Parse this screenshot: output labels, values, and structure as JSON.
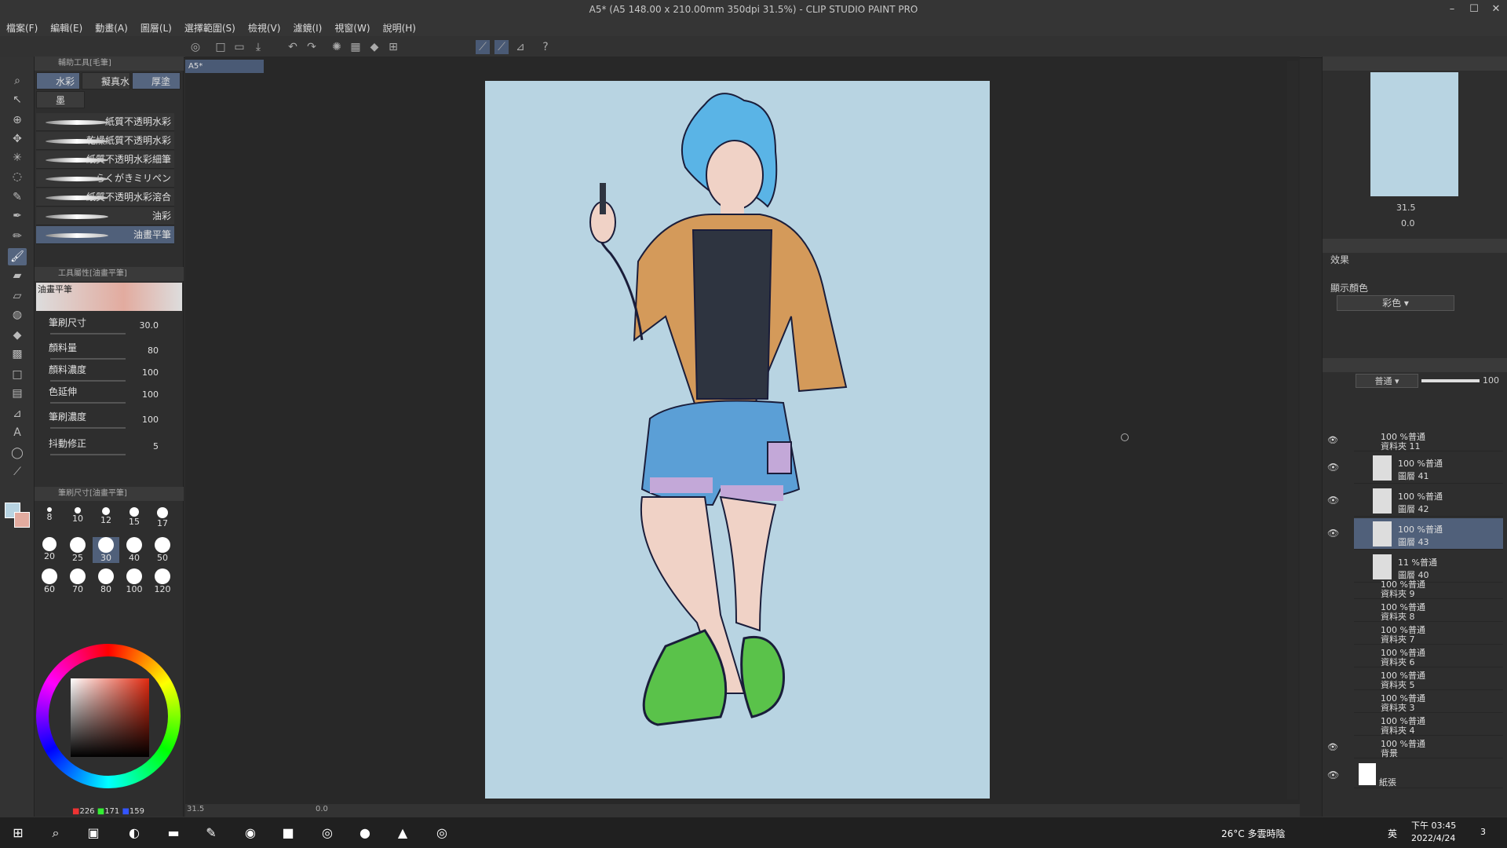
{
  "window": {
    "title": "A5* (A5 148.00 x 210.00mm 350dpi 31.5%)  - CLIP STUDIO PAINT PRO"
  },
  "menu": [
    "檔案(F)",
    "編輯(E)",
    "動畫(A)",
    "圖層(L)",
    "選擇範圍(S)",
    "檢視(V)",
    "濾鏡(I)",
    "視窗(W)",
    "說明(H)"
  ],
  "subtool": {
    "header": "輔助工具[毛筆]",
    "tabs": [
      "水彩",
      "擬真水",
      "厚塗",
      "墨"
    ],
    "brushes": [
      "紙質不透明水彩",
      "乾燥紙質不透明水彩",
      "紙質不透明水彩細筆",
      "らくがきミリペン",
      "紙質不透明水彩溶合",
      "油彩",
      "油畫平筆"
    ],
    "prop_header": "工具屬性[油畫平筆]",
    "brush_name": "油畫平筆",
    "props": [
      {
        "label": "筆刷尺寸",
        "value": "30.0"
      },
      {
        "label": "顏料量",
        "value": "80"
      },
      {
        "label": "顏料濃度",
        "value": "100"
      },
      {
        "label": "色延伸",
        "value": "100"
      },
      {
        "label": "筆刷濃度",
        "value": "100"
      },
      {
        "label": "抖動修正",
        "value": "5"
      }
    ],
    "size_header": "筆刷尺寸[油畫平筆]",
    "sizes": [
      "8",
      "10",
      "12",
      "15",
      "17",
      "20",
      "25",
      "30",
      "40",
      "50",
      "60",
      "70",
      "80",
      "100",
      "120"
    ]
  },
  "color": {
    "r": "226",
    "g": "171",
    "b": "159",
    "main": "#e2ab9f",
    "sub": "#b8d4e2"
  },
  "doc": {
    "tab": "A5*",
    "zoom": "31.5",
    "angle": "0.0"
  },
  "navigator": {
    "zoom": "31.5",
    "angle": "0.0"
  },
  "layerprop": {
    "effect": "效果",
    "display_color": "顯示顏色",
    "color_mode": "彩色"
  },
  "layers": {
    "blend": "普通",
    "opacity": "100",
    "items": [
      {
        "kind": "folder",
        "line1": "100 %普通",
        "line2": "資料夾 11"
      },
      {
        "kind": "layer",
        "line1": "100 %普通",
        "line2": "圖層 41"
      },
      {
        "kind": "layer",
        "line1": "100 %普通",
        "line2": "圖層 42"
      },
      {
        "kind": "layer",
        "line1": "100 %普通",
        "line2": "圖層 43"
      },
      {
        "kind": "layer",
        "line1": "11 %普通",
        "line2": "圖層 40"
      },
      {
        "kind": "folder",
        "line1": "100 %普通",
        "line2": "資料夾 9"
      },
      {
        "kind": "folder",
        "line1": "100 %普通",
        "line2": "資料夾 8"
      },
      {
        "kind": "folder",
        "line1": "100 %普通",
        "line2": "資料夾 7"
      },
      {
        "kind": "folder",
        "line1": "100 %普通",
        "line2": "資料夾 6"
      },
      {
        "kind": "folder",
        "line1": "100 %普通",
        "line2": "資料夾 5"
      },
      {
        "kind": "folder",
        "line1": "100 %普通",
        "line2": "資料夾 3"
      },
      {
        "kind": "folder",
        "line1": "100 %普通",
        "line2": "資料夾 4"
      },
      {
        "kind": "folder",
        "line1": "100 %普通",
        "line2": "背景"
      },
      {
        "kind": "paper",
        "line1": "",
        "line2": "紙張"
      }
    ]
  },
  "taskbar": {
    "weather": "26°C 多雲時陰",
    "time": "下午 03:45",
    "date": "2022/4/24",
    "ime": "英",
    "notif": "3"
  }
}
